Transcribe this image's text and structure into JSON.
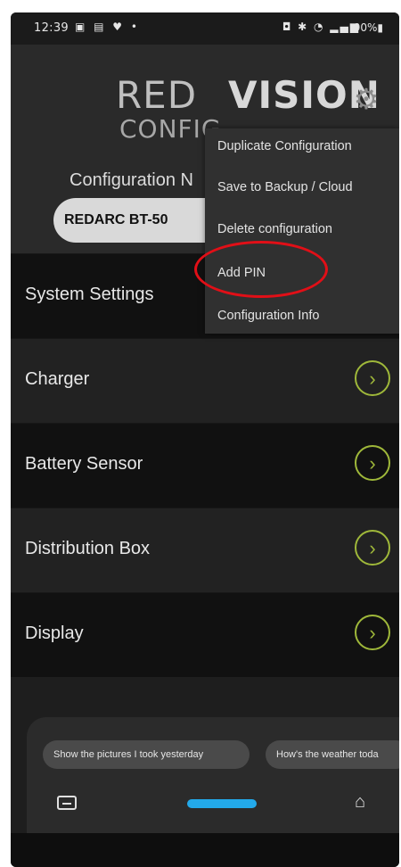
{
  "status_bar": {
    "time": "12:39",
    "left_icons": "▣ ▤ ♥ •",
    "right_icons": "◘ ✱ ◔ ▂▄▆",
    "battery": "90%▮"
  },
  "header": {
    "logo_part1": "RED",
    "logo_part2": "VISION",
    "logo_sub": "CONFIG",
    "config_name_label": "Configuration N",
    "config_name_value": "REDARC BT-50"
  },
  "menu": {
    "items": [
      "Duplicate Configuration",
      "Save to Backup / Cloud",
      "Delete configuration",
      "Add PIN",
      "Configuration Info"
    ]
  },
  "settings_list": {
    "items": [
      {
        "label": "System Settings"
      },
      {
        "label": "Charger"
      },
      {
        "label": "Battery Sensor"
      },
      {
        "label": "Distribution Box"
      },
      {
        "label": "Display"
      }
    ]
  },
  "suggestions": {
    "chips": [
      "Show the pictures I took yesterday",
      "How's the weather toda"
    ]
  },
  "icons": {
    "gear": "gear-icon",
    "chevron": "chevron-right-icon",
    "keyboard": "keyboard-icon",
    "home": "home-icon"
  },
  "colors": {
    "accent_green": "#9fb83a",
    "annotation_red": "#e10f17",
    "pill_blue": "#23a9ea"
  }
}
